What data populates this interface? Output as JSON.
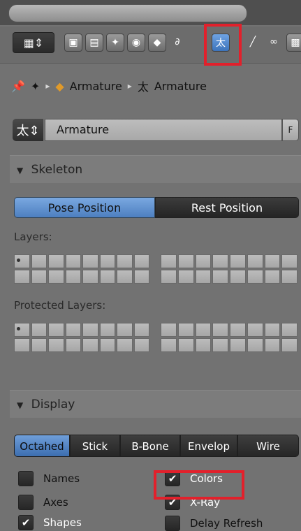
{
  "breadcrumb": {
    "items": [
      "Armature",
      "Armature"
    ]
  },
  "armature_selector": {
    "value": "Armature",
    "fake_user_label": "F"
  },
  "skeleton_panel": {
    "title": "Skeleton",
    "pose_position_label": "Pose Position",
    "rest_position_label": "Rest Position",
    "active": "Pose Position",
    "layers_label": "Layers:",
    "protected_layers_label": "Protected Layers:"
  },
  "display_panel": {
    "title": "Display",
    "bone_types": [
      "Octahed",
      "Stick",
      "B-Bone",
      "Envelop",
      "Wire"
    ],
    "active_bone_type": "Octahed",
    "checkboxes": [
      {
        "label": "Names",
        "checked": false
      },
      {
        "label": "Colors",
        "checked": true
      },
      {
        "label": "Axes",
        "checked": false
      },
      {
        "label": "X-Ray",
        "checked": true
      },
      {
        "label": "Shapes",
        "checked": true
      },
      {
        "label": "Delay Refresh",
        "checked": false
      }
    ]
  },
  "colors": {
    "accent_blue": "#5b8fd0",
    "highlight_red": "#e2202b"
  },
  "icons": [
    "editor-type-icon",
    "render-icon",
    "render-layers-icon",
    "scene-icon",
    "world-icon",
    "object-icon",
    "constraints-icon",
    "armature-data-icon",
    "bone-icon",
    "bone-constraints-icon",
    "pin-icon",
    "scene-breadcrumb-icon",
    "object-breadcrumb-icon",
    "armature-breadcrumb-icon"
  ]
}
